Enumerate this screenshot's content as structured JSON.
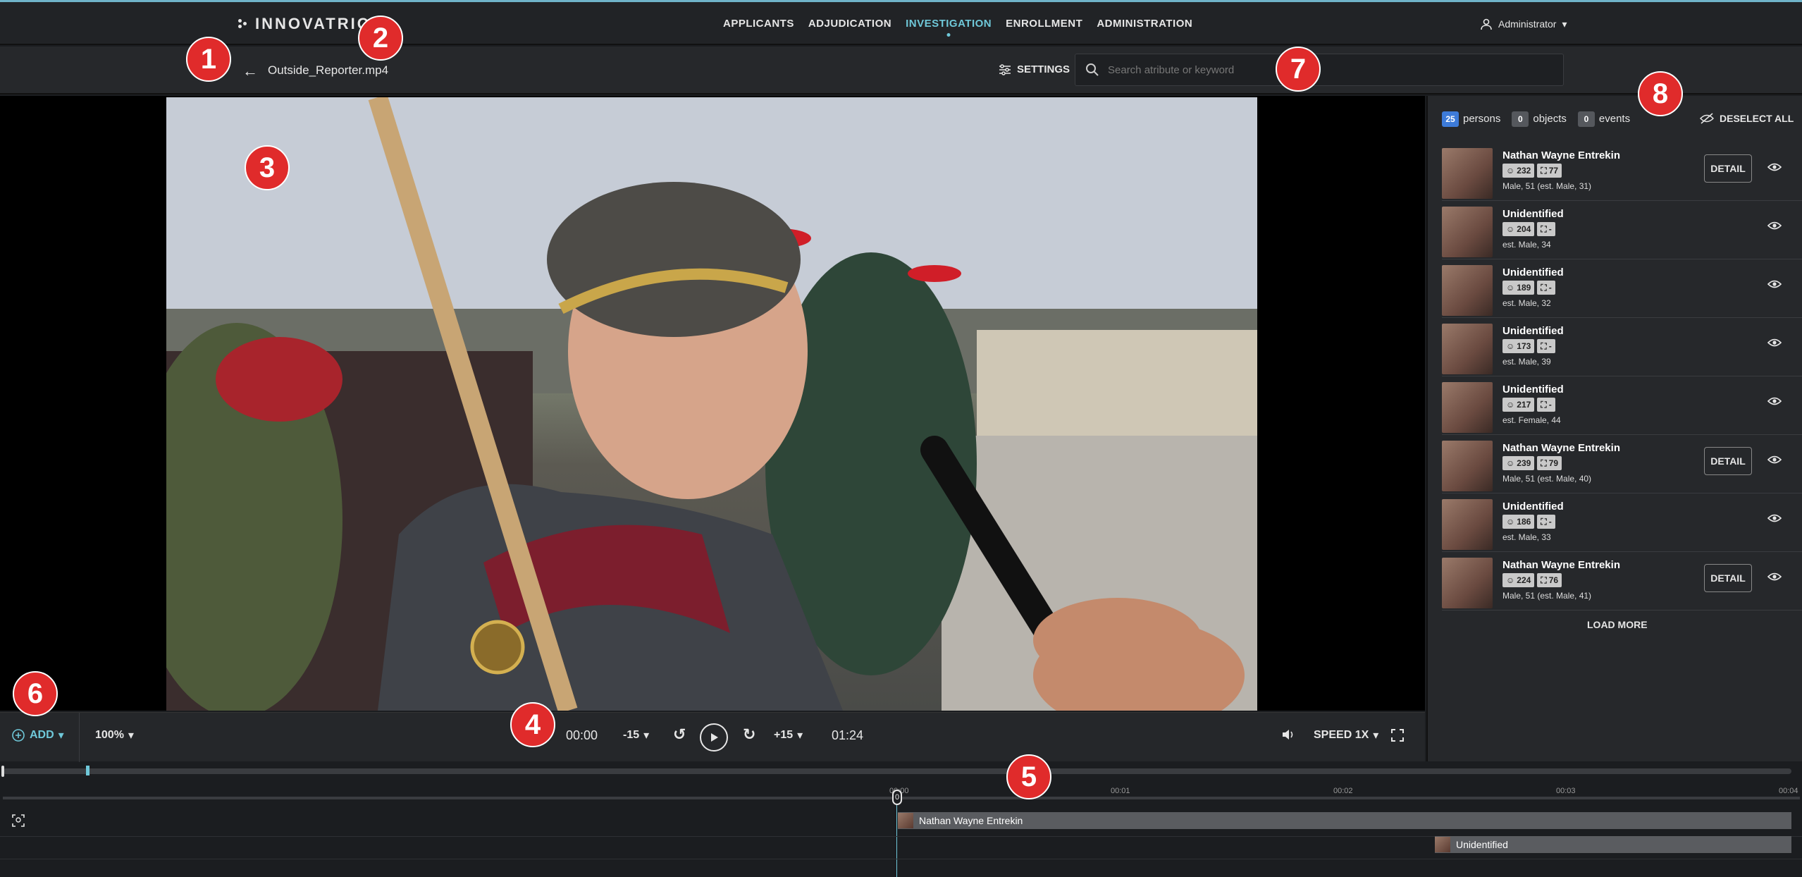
{
  "brand": "INNOVATRICS",
  "nav": [
    "APPLICANTS",
    "ADJUDICATION",
    "INVESTIGATION",
    "ENROLLMENT",
    "ADMINISTRATION"
  ],
  "nav_active": "INVESTIGATION",
  "user": "Administrator",
  "file": {
    "name": "Outside_Reporter.mp4"
  },
  "settings_label": "SETTINGS",
  "search": {
    "placeholder": "Search atribute or keyword",
    "value": ""
  },
  "annotations": [
    "1",
    "2",
    "3",
    "4",
    "5",
    "6",
    "7",
    "8"
  ],
  "filters": {
    "persons_count": "25",
    "persons_label": "persons",
    "objects_count": "0",
    "objects_label": "objects",
    "events_count": "0",
    "events_label": "events"
  },
  "deselect_label": "DESELECT ALL",
  "people": [
    {
      "name": "Nathan Wayne Entrekin",
      "faces": "232",
      "matches": "77",
      "desc": "Male, 51 (est. Male, 31)",
      "detail": true
    },
    {
      "name": "Unidentified",
      "faces": "204",
      "matches": "-",
      "desc": "est. Male, 34",
      "detail": false
    },
    {
      "name": "Unidentified",
      "faces": "189",
      "matches": "-",
      "desc": "est. Male, 32",
      "detail": false
    },
    {
      "name": "Unidentified",
      "faces": "173",
      "matches": "-",
      "desc": "est. Male, 39",
      "detail": false
    },
    {
      "name": "Unidentified",
      "faces": "217",
      "matches": "-",
      "desc": "est. Female, 44",
      "detail": false
    },
    {
      "name": "Nathan Wayne Entrekin",
      "faces": "239",
      "matches": "79",
      "desc": "Male, 51 (est. Male, 40)",
      "detail": true
    },
    {
      "name": "Unidentified",
      "faces": "186",
      "matches": "-",
      "desc": "est. Male, 33",
      "detail": false
    },
    {
      "name": "Nathan Wayne Entrekin",
      "faces": "224",
      "matches": "76",
      "desc": "Male, 51 (est. Male, 41)",
      "detail": true
    }
  ],
  "detail_label": "DETAIL",
  "load_more": "LOAD MORE",
  "controls": {
    "add": "ADD",
    "zoom": "100%",
    "current_time": "00:00",
    "back_step": "-15",
    "fwd_step": "+15",
    "duration": "01:24",
    "speed": "SPEED 1X"
  },
  "timeline": {
    "ticks": [
      "00:00",
      "00:01",
      "00:02",
      "00:03",
      "00:04"
    ],
    "lanes": [
      "Nathan Wayne Entrekin",
      "Unidentified"
    ],
    "playhead_label": "0"
  }
}
